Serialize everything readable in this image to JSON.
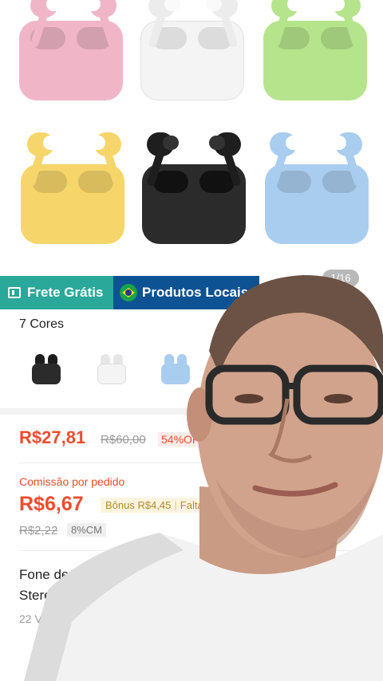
{
  "gallery": {
    "counter": "1/16",
    "colors": {
      "pink": "#f0b6c8",
      "white": "#f4f4f4",
      "green": "#b6e48c",
      "yellow": "#f6d56a",
      "black": "#2b2b2b",
      "blue": "#a9cdef"
    }
  },
  "badges": {
    "frete": "Frete Grátis",
    "local": "Produtos Locais"
  },
  "variants": {
    "title": "7 Cores"
  },
  "price": {
    "current": "R$27,81",
    "original": "R$60,00",
    "discount": "54%OFF"
  },
  "commission": {
    "label": "Comissão por pedido",
    "value": "R$6,67",
    "bonus": "Bônus R$4,45",
    "bonus_extra": "Falta",
    "old": "R$2,22",
    "rate": "8%CM"
  },
  "product": {
    "title": "Fone de Ouvido Bluetooth Stereo Fone",
    "sold": "22 Vendidos"
  }
}
